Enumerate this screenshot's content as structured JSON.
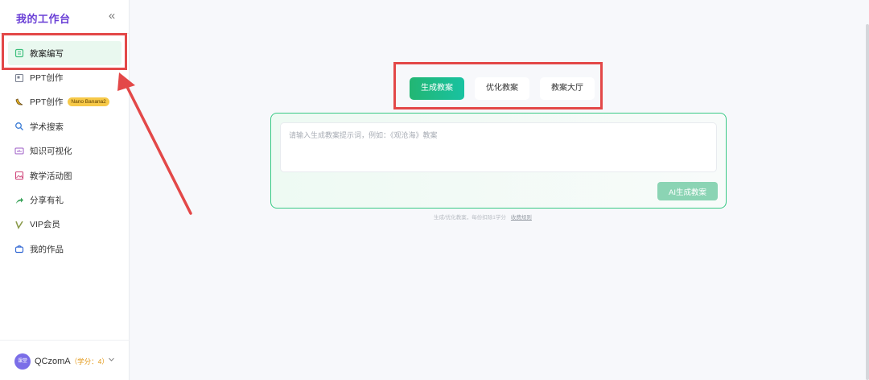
{
  "sidebar": {
    "title": "我的工作台",
    "collapse_icon": "«",
    "items": [
      {
        "label": "教案编写",
        "icon": "lesson-icon",
        "active": true
      },
      {
        "label": "PPT创作",
        "icon": "slides-icon"
      },
      {
        "label": "PPT创作",
        "icon": "banana-icon",
        "badge": "Nano Banana2"
      },
      {
        "label": "学术搜索",
        "icon": "search-icon"
      },
      {
        "label": "知识可视化",
        "icon": "chart-icon"
      },
      {
        "label": "教学活动图",
        "icon": "image-icon"
      },
      {
        "label": "分享有礼",
        "icon": "share-icon"
      },
      {
        "label": "VIP会员",
        "icon": "vip-icon"
      },
      {
        "label": "我的作品",
        "icon": "works-icon"
      }
    ]
  },
  "user": {
    "avatar_text": "课堂",
    "name": "QCzomA",
    "points": "（学分：4）"
  },
  "main": {
    "tabs": [
      {
        "label": "生成教案",
        "active": true
      },
      {
        "label": "优化教案"
      },
      {
        "label": "教案大厅"
      }
    ],
    "input": {
      "placeholder": "请输入生成教案提示词，例如：《观沧海》教案",
      "value": ""
    },
    "generate_button": "AI生成教案",
    "hint": "生成/优化教案，每份扣除1学分",
    "hint_link": "收费规则"
  },
  "colors": {
    "accent_green": "#22b673",
    "brand_purple": "#6a3fd6",
    "annotation_red": "#e34848",
    "badge_yellow": "#f7c948"
  }
}
